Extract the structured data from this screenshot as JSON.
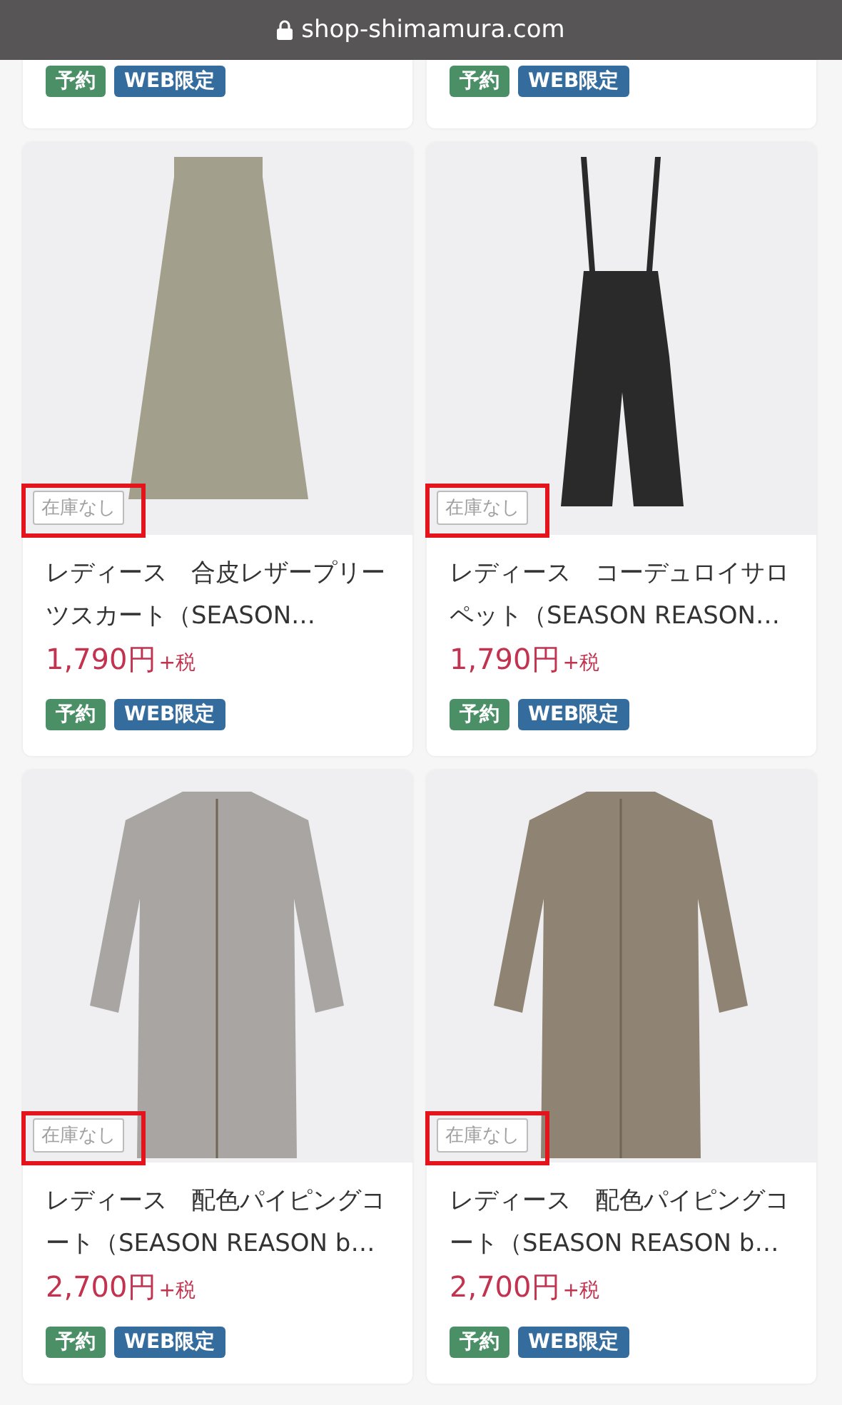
{
  "browser_bar": {
    "url": "shop-shimamura.com"
  },
  "rows": [
    {
      "products": [
        {
          "tags": [
            {
              "kind": "reserve",
              "label": "予約"
            },
            {
              "kind": "web",
              "label": "WEB限定"
            }
          ]
        },
        {
          "tags": [
            {
              "kind": "reserve",
              "label": "予約"
            },
            {
              "kind": "web",
              "label": "WEB限定"
            }
          ]
        }
      ]
    },
    {
      "products": [
        {
          "image": {
            "kind": "skirt",
            "color": "#a39f8d"
          },
          "stock": {
            "label": "在庫なし",
            "highlighted": true
          },
          "title": "レディース　合皮レザープリーツスカート（SEASON…",
          "price": "1,790円",
          "tax": "+税",
          "tags": [
            {
              "kind": "reserve",
              "label": "予約"
            },
            {
              "kind": "web",
              "label": "WEB限定"
            }
          ]
        },
        {
          "image": {
            "kind": "overalls",
            "color": "#2a2a2a"
          },
          "stock": {
            "label": "在庫なし",
            "highlighted": true
          },
          "title": "レディース　コーデュロイサロペット（SEASON REASON…",
          "price": "1,790円",
          "tax": "+税",
          "tags": [
            {
              "kind": "reserve",
              "label": "予約"
            },
            {
              "kind": "web",
              "label": "WEB限定"
            }
          ]
        }
      ]
    },
    {
      "products": [
        {
          "image": {
            "kind": "coat",
            "color": "#a8a5a2"
          },
          "stock": {
            "label": "在庫なし",
            "highlighted": true
          },
          "title": "レディース　配色パイピングコート（SEASON REASON b…",
          "price": "2,700円",
          "tax": "+税",
          "tags": [
            {
              "kind": "reserve",
              "label": "予約"
            },
            {
              "kind": "web",
              "label": "WEB限定"
            }
          ]
        },
        {
          "image": {
            "kind": "coat",
            "color": "#8f8374"
          },
          "stock": {
            "label": "在庫なし",
            "highlighted": true
          },
          "title": "レディース　配色パイピングコート（SEASON REASON b…",
          "price": "2,700円",
          "tax": "+税",
          "tags": [
            {
              "kind": "reserve",
              "label": "予約"
            },
            {
              "kind": "web",
              "label": "WEB限定"
            }
          ]
        }
      ]
    }
  ]
}
